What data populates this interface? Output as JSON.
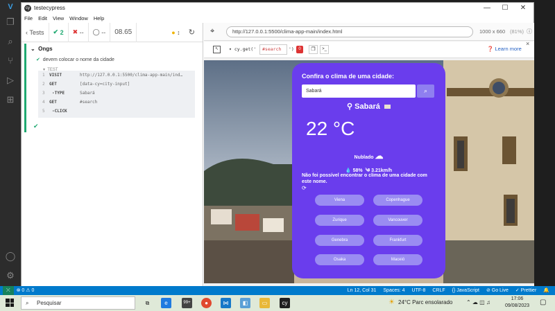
{
  "window": {
    "title": "testecypress",
    "min_glyph": "—",
    "max_glyph": "☐",
    "close_glyph": "✕"
  },
  "menu": [
    "File",
    "Edit",
    "View",
    "Window",
    "Help"
  ],
  "reporter": {
    "tests_label": "Tests",
    "passed": "2",
    "failed": "--",
    "pending": "--",
    "duration": "08.65",
    "suite_name": "Ongs",
    "test_title": "devem colocar o nome da cidade",
    "section": "TEST",
    "commands": [
      {
        "num": "1",
        "name": "VISIT",
        "msg": "http://127.0.0.1:5500/clima-app-main/ind…"
      },
      {
        "num": "2",
        "name": "GET",
        "msg": "[data-cy=city-input]"
      },
      {
        "num": "3",
        "name": "-TYPE",
        "msg": "Sabará"
      },
      {
        "num": "4",
        "name": "GET",
        "msg": "#search"
      },
      {
        "num": "5",
        "name": "-CLICK",
        "msg": ""
      }
    ]
  },
  "aut": {
    "url": "http://127.0.0.1:5500/clima-app-main/index.html",
    "viewport": "1000 x 660",
    "zoom": "(81%)",
    "selector_prefix": "cy.get('",
    "selector": "#search",
    "selector_suffix": "')",
    "selector_count": "0",
    "learn_more": "Learn more"
  },
  "app": {
    "heading": "Confira o clima de uma cidade:",
    "input_value": "Sabará",
    "city": "Sabará",
    "temperature": "22 °C",
    "description": "Nublado",
    "humidity": "58%",
    "wind": "3.21km/h",
    "error": "Não foi possível encontrar o clima de uma cidade com este nome.",
    "suggestions": [
      "Viena",
      "Copenhague",
      "Zurique",
      "Vancouver",
      "Genebra",
      "Frankfurt",
      "Osaka",
      "Maceió"
    ]
  },
  "statusbar": {
    "errors": "⊗ 0 ⚠ 0",
    "position": "Ln 12, Col 31",
    "spaces": "Spaces: 4",
    "encoding": "UTF-8",
    "eol": "CRLF",
    "language": "{} JavaScript",
    "golive": "⊘ Go Live",
    "prettier": "✓ Prettier"
  },
  "taskbar": {
    "search_label": "Pesquisar",
    "weather": "24°C  Parc ensolarado",
    "time": "17:06",
    "date": "09/08/2023",
    "mail_badge": "99+"
  },
  "colors": {
    "card": "#6a3ded",
    "accent": "#1fa971",
    "vscode_status": "#007acc"
  }
}
